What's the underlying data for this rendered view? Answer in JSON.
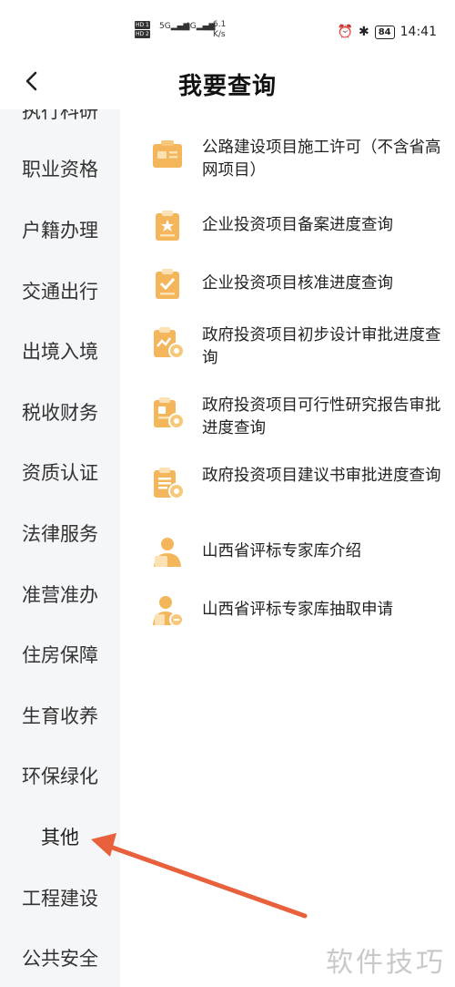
{
  "status_bar": {
    "hd1": "HD 1",
    "hd2": "HD 2",
    "net1": "5G",
    "net2": "4G",
    "speed_value": "6.1",
    "speed_unit": "K/s",
    "battery": "84",
    "time": "14:41"
  },
  "header": {
    "title": "我要查询"
  },
  "sidebar": {
    "partial_top": "执行科研",
    "items": [
      {
        "label": "职业资格"
      },
      {
        "label": "户籍办理"
      },
      {
        "label": "交通出行"
      },
      {
        "label": "出境入境"
      },
      {
        "label": "税收财务"
      },
      {
        "label": "资质认证"
      },
      {
        "label": "法律服务"
      },
      {
        "label": "准营准办"
      },
      {
        "label": "住房保障"
      },
      {
        "label": "生育收养"
      },
      {
        "label": "环保绿化"
      },
      {
        "label": "其他"
      },
      {
        "label": "工程建设"
      },
      {
        "label": "公共安全"
      }
    ],
    "selected": "其他"
  },
  "services": [
    {
      "label": "公路建设项目施工许可（不含省高网项目）",
      "icon": "permit-icon"
    },
    {
      "label": "企业投资项目备案进度查询",
      "icon": "clipboard-star-icon"
    },
    {
      "label": "企业投资项目核准进度查询",
      "icon": "clipboard-check-icon"
    },
    {
      "label": "政府投资项目初步设计审批进度查询",
      "icon": "clipboard-chart-icon"
    },
    {
      "label": "政府投资项目可行性研究报告审批进度查询",
      "icon": "clipboard-report-icon"
    },
    {
      "label": "政府投资项目建议书审批进度查询",
      "icon": "clipboard-doc-icon"
    },
    {
      "label": "山西省评标专家库介绍",
      "icon": "expert-icon"
    },
    {
      "label": "山西省评标专家库抽取申请",
      "icon": "expert-apply-icon"
    }
  ],
  "watermark": "软件技巧",
  "colors": {
    "icon_main": "#f3b65a",
    "icon_light": "#fbe1b4",
    "arrow": "#e8603c",
    "sidebar_bg": "#f5f6f8"
  }
}
